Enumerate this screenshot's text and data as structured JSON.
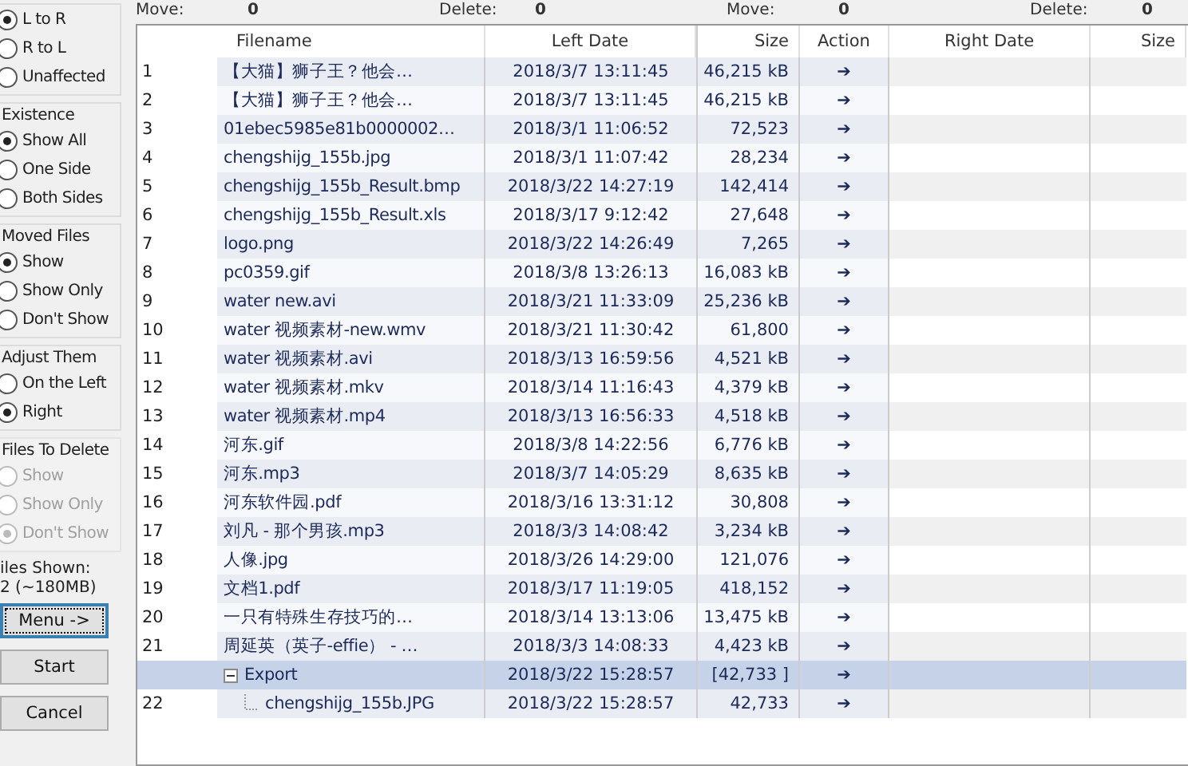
{
  "counts": [
    {
      "label": "Move:",
      "value": "0"
    },
    {
      "label": "Delete:",
      "value": "0"
    },
    {
      "label": "Move:",
      "value": "0"
    },
    {
      "label": "Delete:",
      "value": "0"
    }
  ],
  "groups": [
    {
      "disabled": false,
      "options": [
        {
          "label": "L to R",
          "selected": true
        },
        {
          "label": "R to L",
          "selected": false
        },
        {
          "label": "Unaffected",
          "selected": false
        }
      ]
    },
    {
      "title": "Existence",
      "disabled": false,
      "options": [
        {
          "label": "Show All",
          "selected": true
        },
        {
          "label": "One Side",
          "selected": false
        },
        {
          "label": "Both Sides",
          "selected": false
        }
      ]
    },
    {
      "title": "Moved Files",
      "disabled": false,
      "options": [
        {
          "label": "Show",
          "selected": true
        },
        {
          "label": "Show Only",
          "selected": false
        },
        {
          "label": "Don't Show",
          "selected": false
        }
      ]
    },
    {
      "title": "Adjust Them",
      "disabled": false,
      "options": [
        {
          "label": "On the Left",
          "selected": false
        },
        {
          "label": "Right",
          "selected": true
        }
      ]
    },
    {
      "title": "Files To Delete",
      "disabled": true,
      "options": [
        {
          "label": "Show",
          "selected": false
        },
        {
          "label": "Show Only",
          "selected": false
        },
        {
          "label": "Don't Show",
          "selected": true
        }
      ]
    }
  ],
  "files_shown": {
    "label": "iles Shown:",
    "value": "2 (~180MB)"
  },
  "buttons": [
    {
      "label": "Menu ->",
      "focused": true
    },
    {
      "label": "Start",
      "focused": false
    },
    {
      "label": "Cancel",
      "focused": false
    }
  ],
  "columns": [
    "Filename",
    "Left Date",
    "Size",
    "Action",
    "Right Date",
    "Size"
  ],
  "rows": [
    {
      "number": "1",
      "filename": "【大猫】狮子王？他会…",
      "left_date": "2018/3/7 13:11:45",
      "size": "46,215 kB",
      "action": "➔",
      "selected": false
    },
    {
      "number": "2",
      "filename": "【大猫】狮子王？他会…",
      "left_date": "2018/3/7 13:11:45",
      "size": "46,215 kB",
      "action": "➔",
      "selected": false
    },
    {
      "number": "3",
      "filename": "01ebec5985e81b0000002…",
      "left_date": "2018/3/1 11:06:52",
      "size": "72,523",
      "action": "➔",
      "selected": false
    },
    {
      "number": "4",
      "filename": "chengshijg_155b.jpg",
      "left_date": "2018/3/1 11:07:42",
      "size": "28,234",
      "action": "➔",
      "selected": false
    },
    {
      "number": "5",
      "filename": "chengshijg_155b_Result.bmp",
      "left_date": "2018/3/22 14:27:19",
      "size": "142,414",
      "action": "➔",
      "selected": false
    },
    {
      "number": "6",
      "filename": "chengshijg_155b_Result.xls",
      "left_date": "2018/3/17 9:12:42",
      "size": "27,648",
      "action": "➔",
      "selected": false
    },
    {
      "number": "7",
      "filename": "logo.png",
      "left_date": "2018/3/22 14:26:49",
      "size": "7,265",
      "action": "➔",
      "selected": false
    },
    {
      "number": "8",
      "filename": "pc0359.gif",
      "left_date": "2018/3/8 13:26:13",
      "size": "16,083 kB",
      "action": "➔",
      "selected": false
    },
    {
      "number": "9",
      "filename": "water  new.avi",
      "left_date": "2018/3/21 11:33:09",
      "size": "25,236 kB",
      "action": "➔",
      "selected": false
    },
    {
      "number": "10",
      "filename": "water 视频素材-new.wmv",
      "left_date": "2018/3/21 11:30:42",
      "size": "61,800",
      "action": "➔",
      "selected": false
    },
    {
      "number": "11",
      "filename": "water 视频素材.avi",
      "left_date": "2018/3/13 16:59:56",
      "size": "4,521 kB",
      "action": "➔",
      "selected": false
    },
    {
      "number": "12",
      "filename": "water 视频素材.mkv",
      "left_date": "2018/3/14 11:16:43",
      "size": "4,379 kB",
      "action": "➔",
      "selected": false
    },
    {
      "number": "13",
      "filename": "water 视频素材.mp4",
      "left_date": "2018/3/13 16:56:33",
      "size": "4,518 kB",
      "action": "➔",
      "selected": false
    },
    {
      "number": "14",
      "filename": "河东.gif",
      "left_date": "2018/3/8 14:22:56",
      "size": "6,776 kB",
      "action": "➔",
      "selected": false
    },
    {
      "number": "15",
      "filename": "河东.mp3",
      "left_date": "2018/3/7 14:05:29",
      "size": "8,635 kB",
      "action": "➔",
      "selected": false
    },
    {
      "number": "16",
      "filename": "河东软件园.pdf",
      "left_date": "2018/3/16 13:31:12",
      "size": "30,808",
      "action": "➔",
      "selected": false
    },
    {
      "number": "17",
      "filename": "刘凡 - 那个男孩.mp3",
      "left_date": "2018/3/3 14:08:42",
      "size": "3,234 kB",
      "action": "➔",
      "selected": false
    },
    {
      "number": "18",
      "filename": "人像.jpg",
      "left_date": "2018/3/26 14:29:00",
      "size": "121,076",
      "action": "➔",
      "selected": false
    },
    {
      "number": "19",
      "filename": "文档1.pdf",
      "left_date": "2018/3/17 11:19:05",
      "size": "418,152",
      "action": "➔",
      "selected": false
    },
    {
      "number": "20",
      "filename": "一只有特殊生存技巧的…",
      "left_date": "2018/3/14 13:13:06",
      "size": "13,475 kB",
      "action": "➔",
      "selected": false
    },
    {
      "number": "21",
      "filename": "周延英（英子-effie） - …",
      "left_date": "2018/3/3 14:08:33",
      "size": "4,423 kB",
      "action": "➔",
      "selected": false
    },
    {
      "number": "",
      "filename": "Export",
      "left_date": "2018/3/22 15:28:57",
      "size": "[42,733 ]",
      "action": "➔",
      "selected": true,
      "expanded": true,
      "children": [
        {
          "number": "22",
          "filename": "chengshijg_155b.JPG",
          "left_date": "2018/3/22 15:28:57",
          "size": "42,733",
          "action": "➔",
          "selected": false
        }
      ]
    }
  ]
}
